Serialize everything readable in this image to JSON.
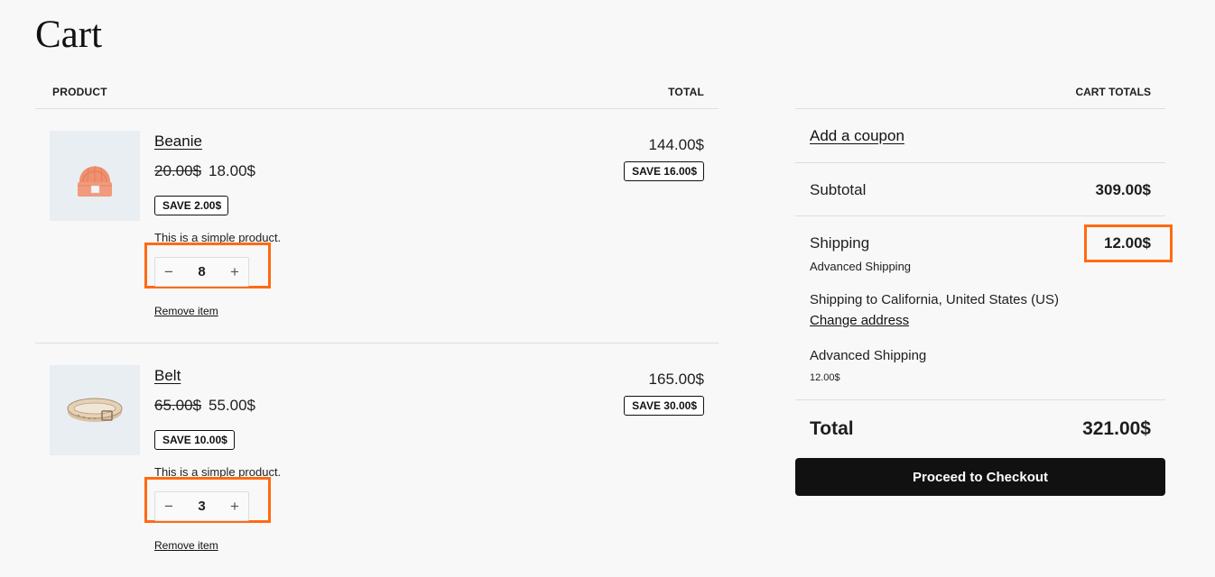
{
  "page": {
    "title": "Cart"
  },
  "table": {
    "product_header": "PRODUCT",
    "total_header": "TOTAL"
  },
  "items": [
    {
      "name": "Beanie",
      "image": "beanie-icon",
      "price_old": "20.00$",
      "price_new": "18.00$",
      "save_badge": "SAVE 2.00$",
      "description": "This is a simple product.",
      "quantity": "8",
      "qty_minus": "−",
      "qty_plus": "+",
      "remove_label": "Remove item",
      "line_total": "144.00$",
      "line_save": "SAVE 16.00$"
    },
    {
      "name": "Belt",
      "image": "belt-icon",
      "price_old": "65.00$",
      "price_new": "55.00$",
      "save_badge": "SAVE 10.00$",
      "description": "This is a simple product.",
      "quantity": "3",
      "qty_minus": "−",
      "qty_plus": "+",
      "remove_label": "Remove item",
      "line_total": "165.00$",
      "line_save": "SAVE 30.00$"
    }
  ],
  "totals": {
    "header": "CART TOTALS",
    "coupon_label": "Add a coupon",
    "subtotal_label": "Subtotal",
    "subtotal_value": "309.00$",
    "shipping_label": "Shipping",
    "shipping_value": "12.00$",
    "shipping_method": "Advanced Shipping",
    "shipping_destination": "Shipping to California, United States (US)",
    "change_address_label": "Change address",
    "shipping_option_name": "Advanced Shipping",
    "shipping_option_price": "12.00$",
    "total_label": "Total",
    "total_value": "321.00$",
    "checkout_label": "Proceed to Checkout"
  },
  "colors": {
    "highlight": "#ff6a13",
    "background": "#f8f8f8",
    "button": "#111111",
    "thumb_bg": "#e9eef3"
  }
}
